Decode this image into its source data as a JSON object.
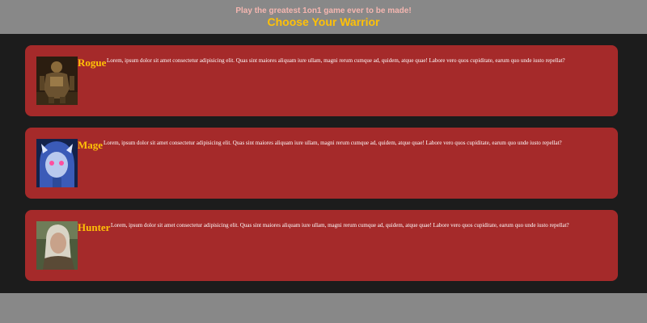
{
  "header": {
    "tagline": "Play the greatest 1on1 game ever to be made!",
    "title": "Choose Your Warrior"
  },
  "warriors": [
    {
      "name": "Rogue",
      "description": "Lorem, ipsum dolor sit amet consectetur adipisicing elit. Quas sint maiores aliquam iure ullam, magni rerum cumque ad, quidem, atque quae! Labore vero quos cupiditate, earum quo unde iusto repellat?"
    },
    {
      "name": "Mage",
      "description": "Lorem, ipsum dolor sit amet consectetur adipisicing elit. Quas sint maiores aliquam iure ullam, magni rerum cumque ad, quidem, atque quae! Labore vero quos cupiditate, earum quo unde iusto repellat?"
    },
    {
      "name": "Hunter",
      "description": "Lorem, ipsum dolor sit amet consectetur adipisicing elit. Quas sint maiores aliquam iure ullam, magni rerum cumque ad, quidem, atque quae! Labore vero quos cupiditate, earum quo unde iusto repellat?"
    }
  ],
  "colors": {
    "page_background": "#888888",
    "main_background": "#1c1c1c",
    "card_background": "#a52a2a",
    "name_color": "#ffc107",
    "title_color": "#ffc107",
    "tagline_color": "#f4b6b0",
    "description_color": "#ffffff"
  }
}
